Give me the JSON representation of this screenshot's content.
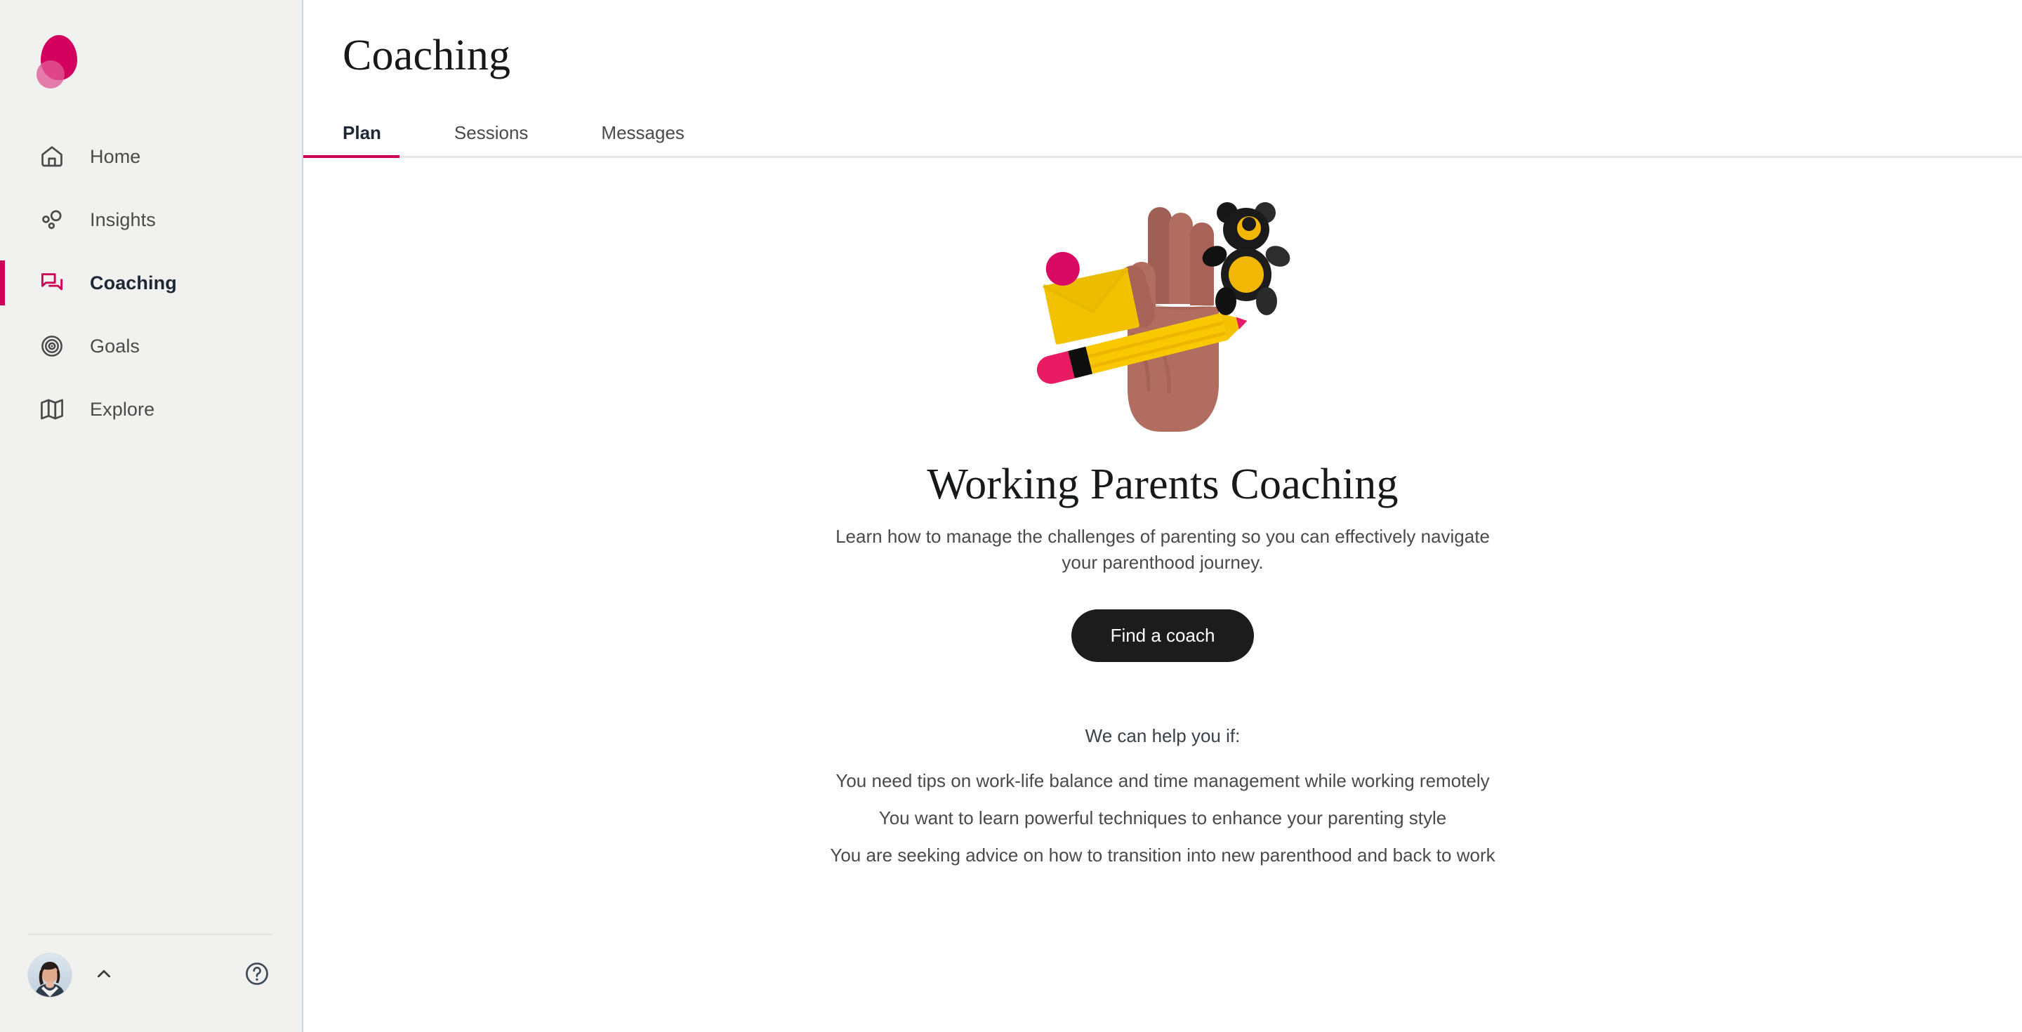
{
  "brand": {
    "logo_name": "balloon-logo",
    "primary_color": "#cc0056",
    "accent_pink": "#e25a96"
  },
  "sidebar": {
    "items": [
      {
        "label": "Home",
        "icon": "home-icon",
        "active": false
      },
      {
        "label": "Insights",
        "icon": "insights-icon",
        "active": false
      },
      {
        "label": "Coaching",
        "icon": "coaching-icon",
        "active": true
      },
      {
        "label": "Goals",
        "icon": "goals-icon",
        "active": false
      },
      {
        "label": "Explore",
        "icon": "explore-icon",
        "active": false
      }
    ],
    "footer": {
      "avatar_name": "user-avatar",
      "expand_icon": "chevron-up-icon",
      "help_icon": "help-circle-icon"
    }
  },
  "header": {
    "title": "Coaching"
  },
  "tabs": [
    {
      "label": "Plan",
      "active": true
    },
    {
      "label": "Sessions",
      "active": false
    },
    {
      "label": "Messages",
      "active": false
    }
  ],
  "main": {
    "illustration_name": "hand-pencil-teddy-envelope-illustration",
    "hero_title": "Working Parents Coaching",
    "hero_subtitle": "Learn how to manage the challenges of parenting so you can effectively navigate your parenthood journey.",
    "cta_label": "Find a coach",
    "help_heading": "We can help you if:",
    "help_items": [
      "You need tips on work-life balance and time management while working remotely",
      "You want to learn powerful techniques to enhance your parenting style",
      "You are seeking advice on how to transition into new parenthood and back to work"
    ]
  }
}
